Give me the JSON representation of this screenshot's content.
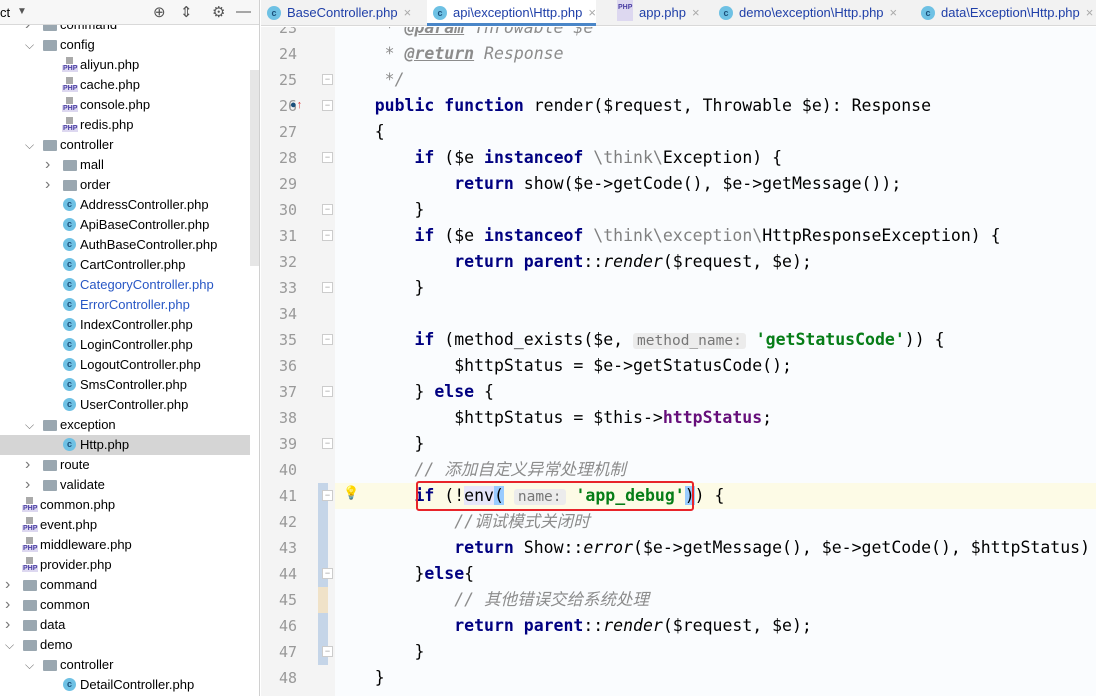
{
  "sidebar": {
    "title": "ct",
    "tree": [
      {
        "label": "command",
        "level": 1,
        "type": "folder",
        "arrow": "right"
      },
      {
        "label": "config",
        "level": 1,
        "type": "folder",
        "arrow": "down"
      },
      {
        "label": "aliyun.php",
        "level": 2,
        "type": "php"
      },
      {
        "label": "cache.php",
        "level": 2,
        "type": "php"
      },
      {
        "label": "console.php",
        "level": 2,
        "type": "php"
      },
      {
        "label": "redis.php",
        "level": 2,
        "type": "php"
      },
      {
        "label": "controller",
        "level": 1,
        "type": "folder",
        "arrow": "down"
      },
      {
        "label": "mall",
        "level": 2,
        "type": "folder",
        "arrow": "right"
      },
      {
        "label": "order",
        "level": 2,
        "type": "folder",
        "arrow": "right"
      },
      {
        "label": "AddressController.php",
        "level": 2,
        "type": "class"
      },
      {
        "label": "ApiBaseController.php",
        "level": 2,
        "type": "class"
      },
      {
        "label": "AuthBaseController.php",
        "level": 2,
        "type": "class"
      },
      {
        "label": "CartController.php",
        "level": 2,
        "type": "class"
      },
      {
        "label": "CategoryController.php",
        "level": 2,
        "type": "class",
        "modified": true
      },
      {
        "label": "ErrorController.php",
        "level": 2,
        "type": "class",
        "modified": true
      },
      {
        "label": "IndexController.php",
        "level": 2,
        "type": "class"
      },
      {
        "label": "LoginController.php",
        "level": 2,
        "type": "class"
      },
      {
        "label": "LogoutController.php",
        "level": 2,
        "type": "class"
      },
      {
        "label": "SmsController.php",
        "level": 2,
        "type": "class"
      },
      {
        "label": "UserController.php",
        "level": 2,
        "type": "class"
      },
      {
        "label": "exception",
        "level": 1,
        "type": "folder",
        "arrow": "down"
      },
      {
        "label": "Http.php",
        "level": 2,
        "type": "class",
        "selected": true
      },
      {
        "label": "route",
        "level": 1,
        "type": "folder",
        "arrow": "right"
      },
      {
        "label": "validate",
        "level": 1,
        "type": "folder",
        "arrow": "right"
      },
      {
        "label": "common.php",
        "level": 1,
        "type": "php"
      },
      {
        "label": "event.php",
        "level": 1,
        "type": "php"
      },
      {
        "label": "middleware.php",
        "level": 1,
        "type": "php"
      },
      {
        "label": "provider.php",
        "level": 1,
        "type": "php"
      },
      {
        "label": "command",
        "level": 0,
        "type": "folder",
        "arrow": "right"
      },
      {
        "label": "common",
        "level": 0,
        "type": "folder",
        "arrow": "right"
      },
      {
        "label": "data",
        "level": 0,
        "type": "folder",
        "arrow": "right"
      },
      {
        "label": "demo",
        "level": 0,
        "type": "folder",
        "arrow": "down"
      },
      {
        "label": "controller",
        "level": 1,
        "type": "folder",
        "arrow": "down"
      },
      {
        "label": "DetailController.php",
        "level": 2,
        "type": "class"
      }
    ]
  },
  "tabs": [
    {
      "label": "BaseController.php",
      "icon": "class"
    },
    {
      "label": "api\\exception\\Http.php",
      "icon": "class",
      "active": true
    },
    {
      "label": "app.php",
      "icon": "php"
    },
    {
      "label": "demo\\exception\\Http.php",
      "icon": "class"
    },
    {
      "label": "data\\Exception\\Http.php",
      "icon": "class"
    }
  ],
  "editor": {
    "first_line": 23,
    "highlight_line": 41,
    "changed_lines": [
      41,
      42,
      43,
      44,
      46,
      47
    ],
    "modified_lines": [
      45
    ],
    "lines": [
      [
        [
          "doc",
          "     * "
        ],
        [
          "tag",
          "@param"
        ],
        [
          "doc",
          " Throwable $e"
        ]
      ],
      [
        [
          "doc",
          "     * "
        ],
        [
          "tag",
          "@return"
        ],
        [
          "doc",
          " Response"
        ]
      ],
      [
        [
          "doc",
          "     */"
        ]
      ],
      [
        [
          "",
          "    "
        ],
        [
          "kw",
          "public function"
        ],
        [
          "",
          " render($request, Throwable $e): Response"
        ]
      ],
      [
        [
          "",
          "    {"
        ]
      ],
      [
        [
          "",
          "        "
        ],
        [
          "kw",
          "if"
        ],
        [
          "",
          " ($e "
        ],
        [
          "kw",
          "instanceof"
        ],
        [
          "ns",
          " \\think\\"
        ],
        [
          "",
          "Exception) {"
        ]
      ],
      [
        [
          "",
          "            "
        ],
        [
          "kw",
          "return"
        ],
        [
          "",
          " show($e->getCode(), $e->getMessage());"
        ]
      ],
      [
        [
          "",
          "        }"
        ]
      ],
      [
        [
          "",
          "        "
        ],
        [
          "kw",
          "if"
        ],
        [
          "",
          " ($e "
        ],
        [
          "kw",
          "instanceof"
        ],
        [
          "ns",
          " \\think\\exception\\"
        ],
        [
          "",
          "HttpResponseException) {"
        ]
      ],
      [
        [
          "",
          "            "
        ],
        [
          "kw",
          "return parent"
        ],
        [
          "",
          "::"
        ],
        [
          "it",
          "render"
        ],
        [
          "",
          "($request, $e);"
        ]
      ],
      [
        [
          "",
          "        }"
        ]
      ],
      [],
      [
        [
          "",
          "        "
        ],
        [
          "kw",
          "if"
        ],
        [
          "",
          " (method_exists($e, "
        ],
        [
          "hint",
          "method_name:"
        ],
        [
          "",
          " "
        ],
        [
          "str",
          "'getStatusCode'"
        ],
        [
          "",
          ")) {"
        ]
      ],
      [
        [
          "",
          "            $httpStatus = $e->getStatusCode();"
        ]
      ],
      [
        [
          "",
          "        } "
        ],
        [
          "kw",
          "else"
        ],
        [
          "",
          " {"
        ]
      ],
      [
        [
          "",
          "            $httpStatus = $this->"
        ],
        [
          "fld",
          "httpStatus"
        ],
        [
          "",
          ";"
        ]
      ],
      [
        [
          "",
          "        }"
        ]
      ],
      [
        [
          "cm",
          "        // 添加自定义异常处理机制"
        ]
      ],
      [
        [
          "",
          "        "
        ],
        [
          "kw",
          "if"
        ],
        [
          "",
          " (!"
        ],
        [
          "envh",
          "env"
        ],
        [
          "brm",
          "("
        ],
        [
          "",
          " "
        ],
        [
          "hint",
          "name:"
        ],
        [
          "",
          " "
        ],
        [
          "str",
          "'app_debug'"
        ],
        [
          "brm",
          ")"
        ],
        [
          "",
          ") {"
        ]
      ],
      [
        [
          "cm",
          "            //调试模式关闭时"
        ]
      ],
      [
        [
          "",
          "            "
        ],
        [
          "kw",
          "return"
        ],
        [
          "",
          " Show::"
        ],
        [
          "it",
          "error"
        ],
        [
          "",
          "($e->getMessage(), $e->getCode(), $httpStatus)"
        ]
      ],
      [
        [
          "",
          "        }"
        ],
        [
          "kw",
          "else"
        ],
        [
          "",
          "{"
        ]
      ],
      [
        [
          "cm",
          "            // 其他错误交给系统处理"
        ]
      ],
      [
        [
          "",
          "            "
        ],
        [
          "kw",
          "return parent"
        ],
        [
          "",
          "::"
        ],
        [
          "it",
          "render"
        ],
        [
          "",
          "($request, $e);"
        ]
      ],
      [
        [
          "",
          "        }"
        ]
      ],
      [
        [
          "",
          "    }"
        ]
      ]
    ]
  }
}
